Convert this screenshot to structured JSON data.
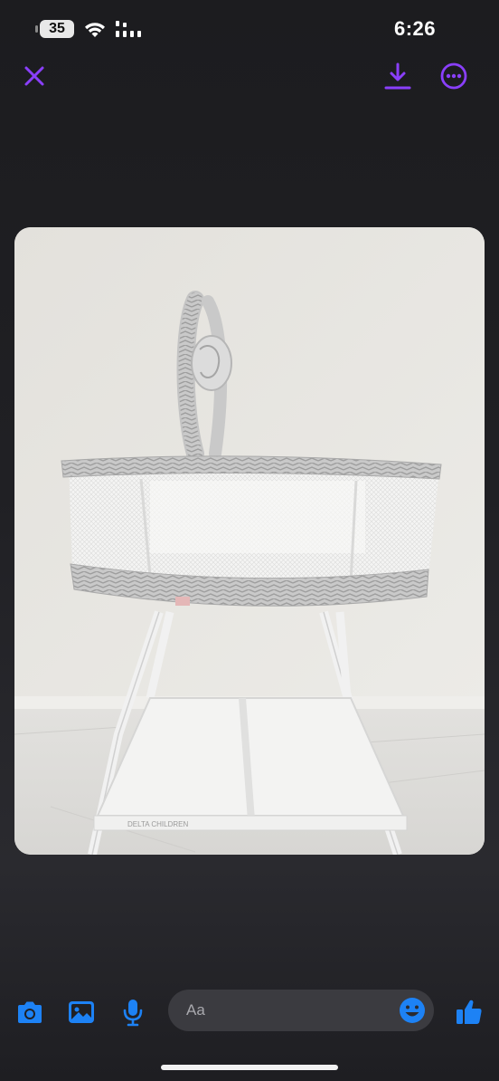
{
  "status_bar": {
    "battery_level": "35",
    "time": "6:26"
  },
  "top_bar": {
    "close_icon": "close-icon",
    "download_icon": "download-icon",
    "more_icon": "more-options-icon",
    "accent_color": "#8a3ffc"
  },
  "photo": {
    "subject": "bassinet-photo",
    "brand_label": "DELTA CHILDREN"
  },
  "composer": {
    "placeholder": "Aa",
    "icons": [
      "camera-icon",
      "gallery-icon",
      "microphone-icon",
      "emoji-icon",
      "thumbs-up-icon"
    ],
    "accent_color": "#1d82f5"
  }
}
